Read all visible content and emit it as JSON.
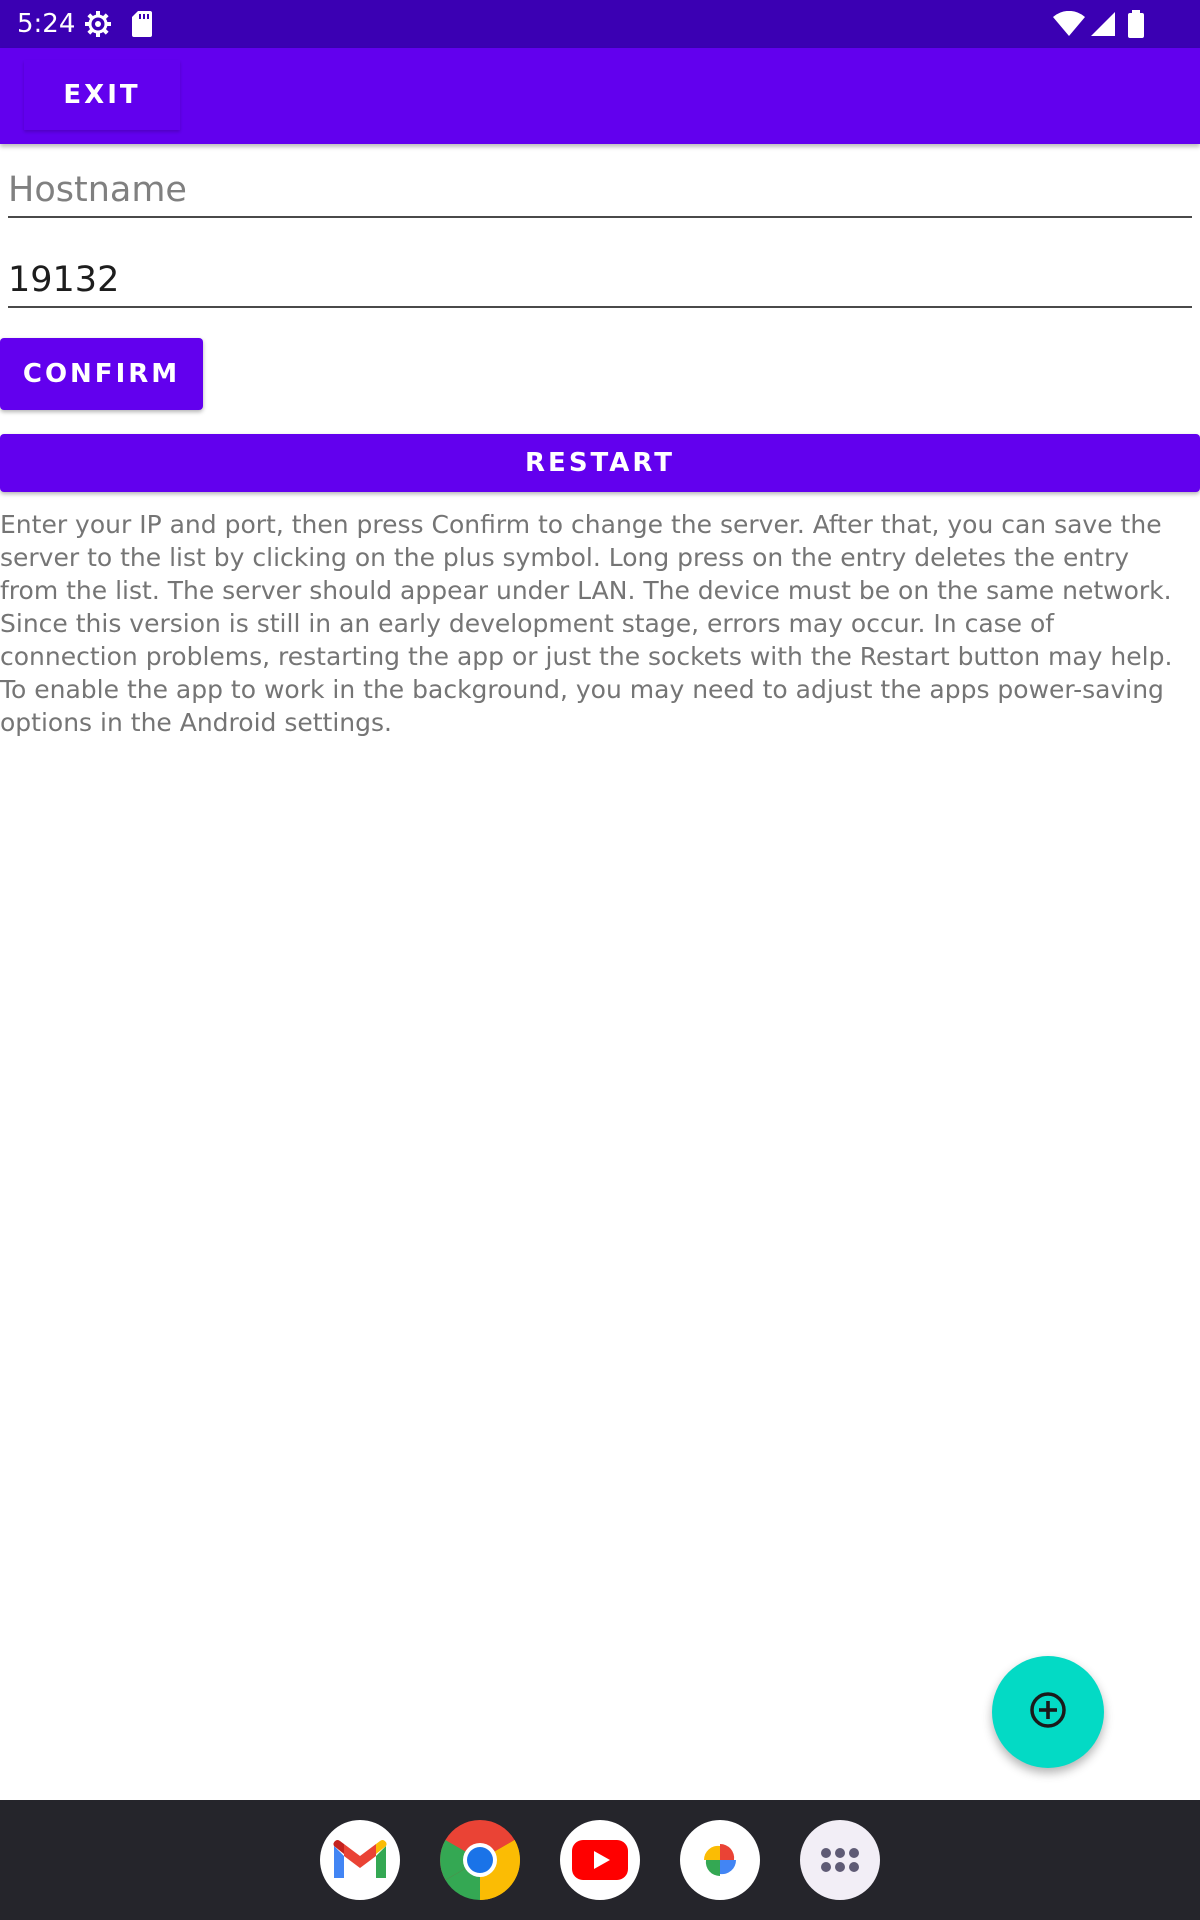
{
  "status_bar": {
    "time": "5:24",
    "icons": [
      "gear-icon",
      "sd-card-icon",
      "wifi-icon",
      "signal-icon",
      "battery-icon"
    ],
    "background": "#3b00b3"
  },
  "app_bar": {
    "exit_label": "EXIT",
    "background": "#6200ee"
  },
  "form": {
    "hostname": {
      "value": "",
      "placeholder": "Hostname"
    },
    "port": {
      "value": "19132",
      "placeholder": ""
    },
    "confirm_label": "CONFIRM",
    "restart_label": "RESTART"
  },
  "info_text": "Enter your IP and port, then press Confirm to change the server. After that, you can save the server to the list by clicking on the plus symbol. Long press on the entry deletes the entry from the list. The server should appear under LAN. The device must be on the same network. Since this version is still in an early development stage, errors may occur. In case of connection problems, restarting the app or just the sockets with the Restart button may help. To enable the app to work in the background, you may need to adjust the apps power-saving options in the Android settings.",
  "fab": {
    "icon": "add-circle-icon",
    "color": "#03dac5"
  },
  "dock": {
    "apps": [
      "gmail-icon",
      "chrome-icon",
      "youtube-icon",
      "photos-icon",
      "app-drawer-icon"
    ]
  },
  "colors": {
    "accent": "#6200ee",
    "fab": "#03dac5",
    "text_secondary": "#757575"
  }
}
